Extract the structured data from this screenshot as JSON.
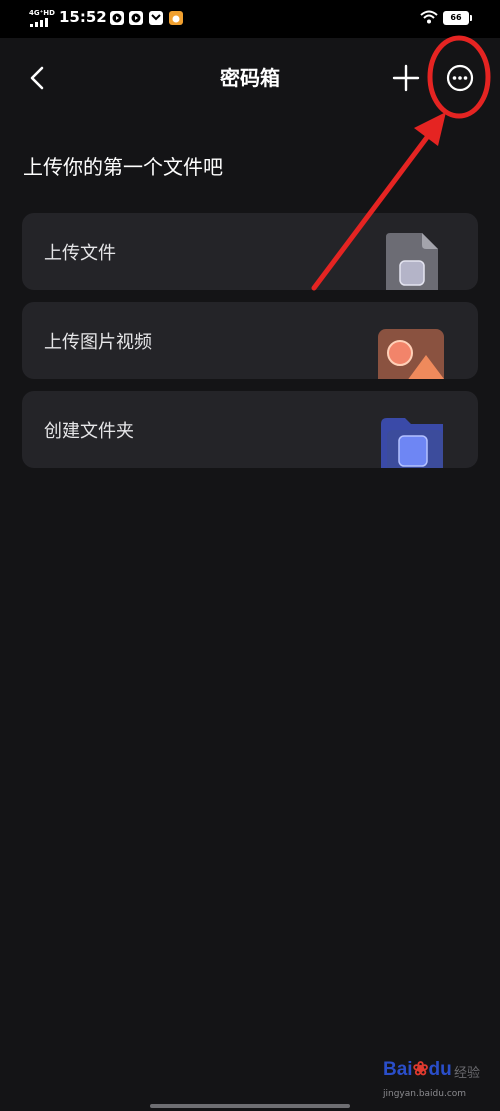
{
  "status_bar": {
    "network": "4G⁺HD",
    "time": "15:52",
    "battery": "66",
    "notification_icons": [
      "play-icon",
      "play-icon",
      "mail-icon",
      "app-icon"
    ]
  },
  "header": {
    "title": "密码箱",
    "back_icon": "chevron-left-icon",
    "add_icon": "plus-icon",
    "more_icon": "more-icon"
  },
  "main": {
    "heading": "上传你的第一个文件吧",
    "cards": [
      {
        "label": "上传文件",
        "icon": "file-icon"
      },
      {
        "label": "上传图片视频",
        "icon": "image-icon"
      },
      {
        "label": "创建文件夹",
        "icon": "folder-icon"
      }
    ]
  },
  "annotation": {
    "color": "#e52422"
  },
  "watermark": {
    "logo": "Bai",
    "logo_paw": "❀",
    "logo_du": "du",
    "cn": "经验",
    "url": "jingyan.baidu.com"
  },
  "colors": {
    "background": "#141416",
    "card": "#242428",
    "text": "#ffffff"
  }
}
